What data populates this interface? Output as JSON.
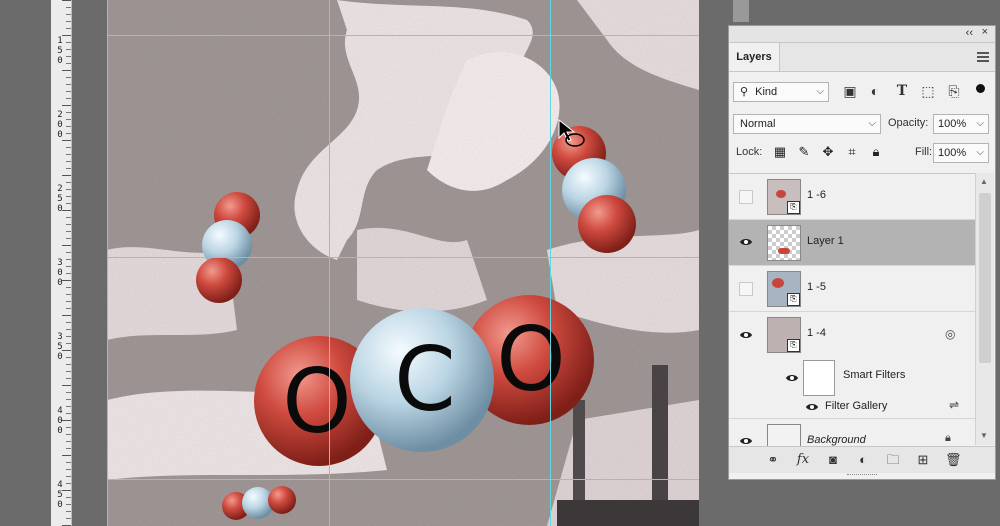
{
  "ruler": {
    "labels": [
      "1 5 0",
      "2 0 0",
      "2 5 0",
      "3 0 0",
      "3 5 0",
      "4 0 0",
      "4 5 0"
    ]
  },
  "canvas": {
    "molecule_letters": [
      "O",
      "C",
      "O"
    ],
    "colors": {
      "oxygen": "#c8453c",
      "carbon": "#b9d4e2",
      "guide": "#5fd6e0",
      "sky": "#efe5e6"
    }
  },
  "panel": {
    "collapse_icon": "double-chevron-left-icon",
    "close_label": "×",
    "tab_label": "Layers",
    "filter": {
      "kind_label": "Kind",
      "search_icon": "search-icon"
    },
    "blend_mode": "Normal",
    "opacity_label": "Opacity:",
    "opacity_value": "100%",
    "lock_label": "Lock:",
    "fill_label": "Fill:",
    "fill_value": "100%",
    "layers": [
      {
        "name": "1 -6",
        "visible": false,
        "selected": false,
        "smart_object": true
      },
      {
        "name": "Layer 1",
        "visible": true,
        "selected": true,
        "smart_object": false
      },
      {
        "name": "1 -5",
        "visible": false,
        "selected": false,
        "smart_object": true
      },
      {
        "name": "1 -4",
        "visible": true,
        "selected": false,
        "smart_object": true
      },
      {
        "name": "Smart Filters",
        "visible": true,
        "selected": false,
        "sub": true
      },
      {
        "name": "Filter Gallery",
        "visible": true,
        "selected": false,
        "sub": true
      },
      {
        "name": "Background",
        "visible": true,
        "selected": false,
        "locked": true
      }
    ],
    "bottom_icons": [
      "link-icon",
      "fx-icon",
      "mask-icon",
      "adjustment-icon",
      "folder-icon",
      "new-layer-icon",
      "trash-icon"
    ]
  }
}
